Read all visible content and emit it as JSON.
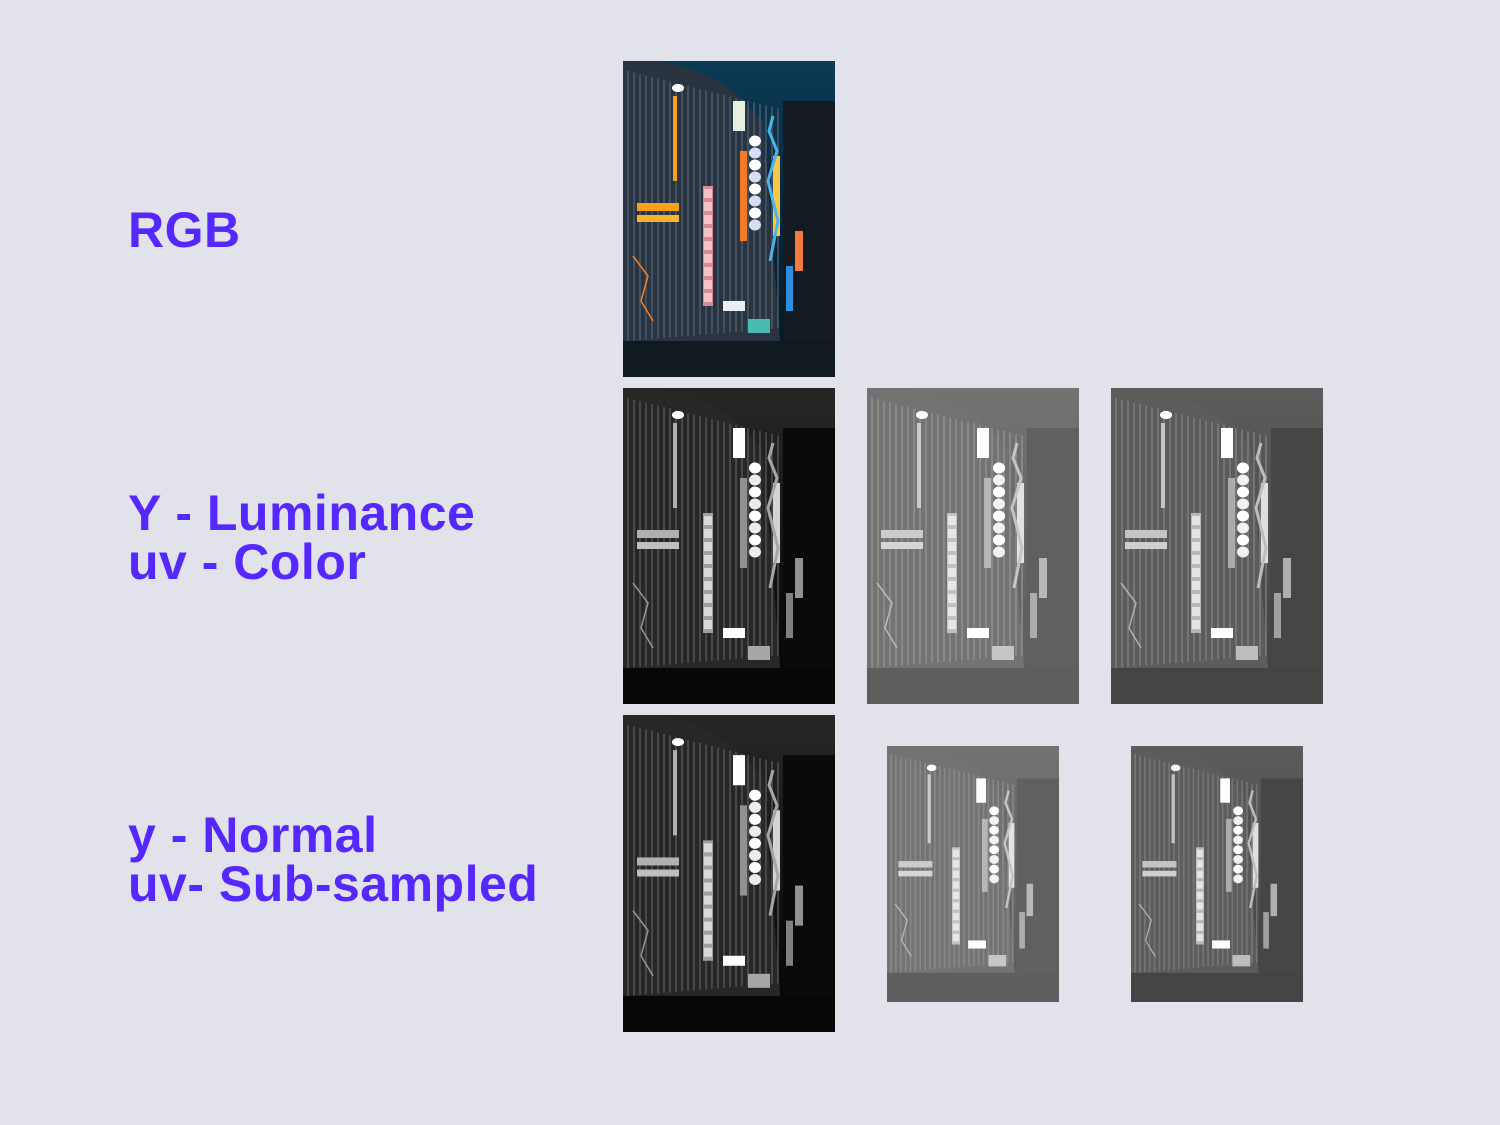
{
  "labels": {
    "rgb": "RGB",
    "yuv_line1": "Y - Luminance",
    "yuv_line2": "uv - Color",
    "sub_line1": "y - Normal",
    "sub_line2": "uv- Sub-sampled"
  },
  "colors": {
    "accent": "#5528ff",
    "background": "#e2e2eb"
  },
  "images": {
    "rgb": "photo-neon-building-color",
    "y": "photo-neon-building-luma",
    "u": "photo-neon-building-u-channel",
    "v": "photo-neon-building-v-channel",
    "y_normal": "photo-neon-building-luma",
    "u_subsampled": "photo-neon-building-u-channel-subsampled",
    "v_subsampled": "photo-neon-building-v-channel-subsampled"
  }
}
